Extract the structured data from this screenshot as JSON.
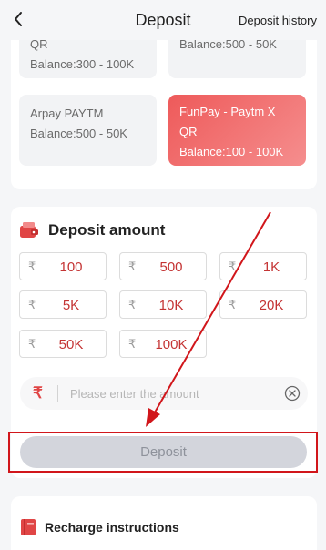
{
  "header": {
    "title": "Deposit",
    "history_label": "Deposit history"
  },
  "channels": [
    {
      "name": "QR",
      "balance": "Balance:300 - 100K",
      "active": false
    },
    {
      "name": "",
      "balance": "Balance:500 - 50K",
      "active": false
    },
    {
      "name": "Arpay PAYTM",
      "balance": "Balance:500 - 50K",
      "active": false
    },
    {
      "name_line1": "FunPay - Paytm X",
      "name_line2": "QR",
      "balance": "Balance:100 - 100K",
      "active": true
    }
  ],
  "deposit_amount": {
    "title": "Deposit amount",
    "currency_symbol": "₹",
    "amounts": [
      "100",
      "500",
      "1K",
      "5K",
      "10K",
      "20K",
      "50K",
      "100K"
    ],
    "input_placeholder": "Please enter the amount",
    "button_label": "Deposit"
  },
  "instructions": {
    "title": "Recharge instructions"
  },
  "colors": {
    "accent_red": "#e04545",
    "active_tile_gradient": [
      "#ee5a5a",
      "#f58e8e"
    ],
    "annotation_red": "#d1161b",
    "disabled_button": "#d3d5dc"
  },
  "icons": {
    "back": "chevron-left-icon",
    "wallet": "wallet-icon",
    "clear": "clear-circle-icon",
    "book": "book-icon"
  }
}
